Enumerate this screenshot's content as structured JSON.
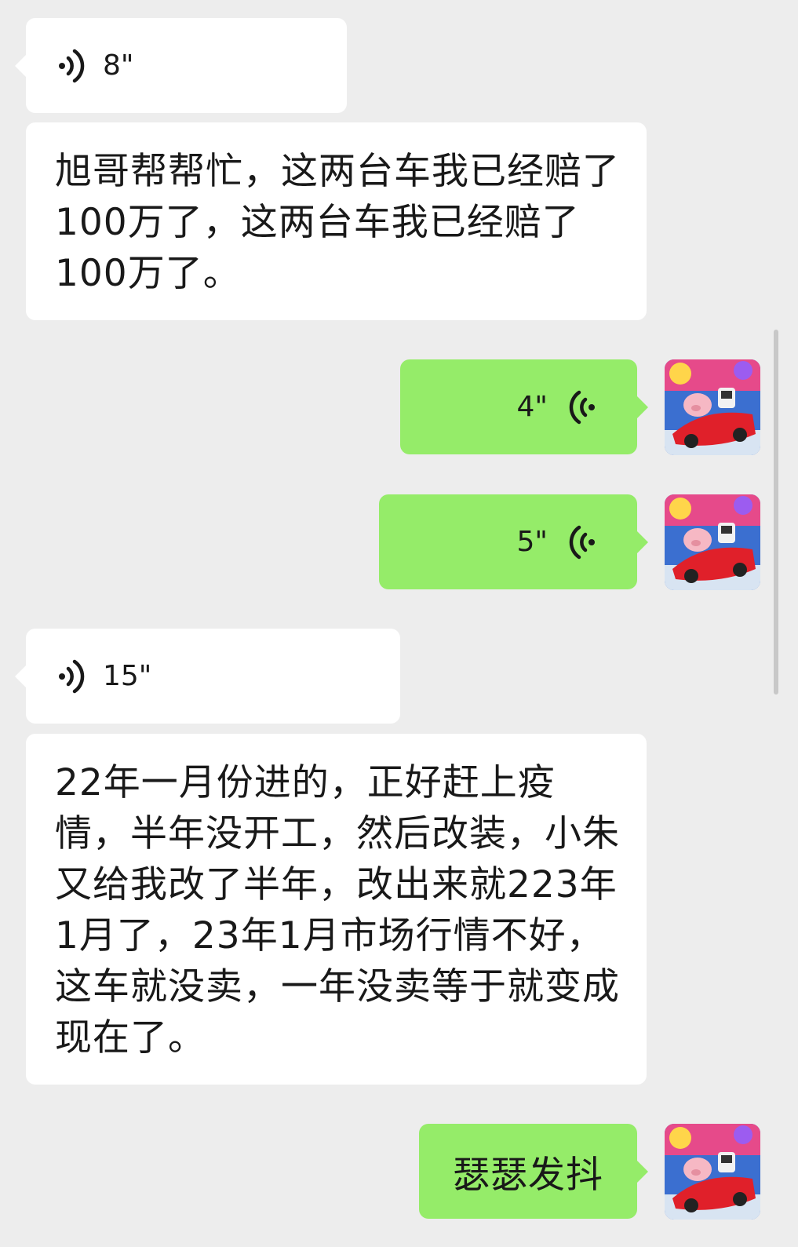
{
  "messages": [
    {
      "side": "in",
      "type": "voice",
      "duration": "8\""
    },
    {
      "side": "in",
      "type": "text",
      "text": "旭哥帮帮忙，这两台车我已经赔了100万了，这两台车我已经赔了100万了。"
    },
    {
      "side": "out",
      "type": "voice",
      "duration": "4\""
    },
    {
      "side": "out",
      "type": "voice",
      "duration": "5\""
    },
    {
      "side": "in",
      "type": "voice",
      "duration": "15\""
    },
    {
      "side": "in",
      "type": "text",
      "text": "22年一月份进的，正好赶上疫情，半年没开工，然后改装，小朱又给我改了半年，改出来就223年1月了，23年1月市场行情不好，这车就没卖，一年没卖等于就变成现在了。"
    },
    {
      "side": "out",
      "type": "text",
      "text": "瑟瑟发抖"
    }
  ],
  "colors": {
    "background": "#ededed",
    "incoming_bubble": "#ffffff",
    "outgoing_bubble": "#95ec69",
    "text": "#191919"
  },
  "icons": {
    "voice_incoming": "voice-wave-icon",
    "voice_outgoing": "voice-wave-icon",
    "avatar": "user-avatar-pig-racecar"
  }
}
